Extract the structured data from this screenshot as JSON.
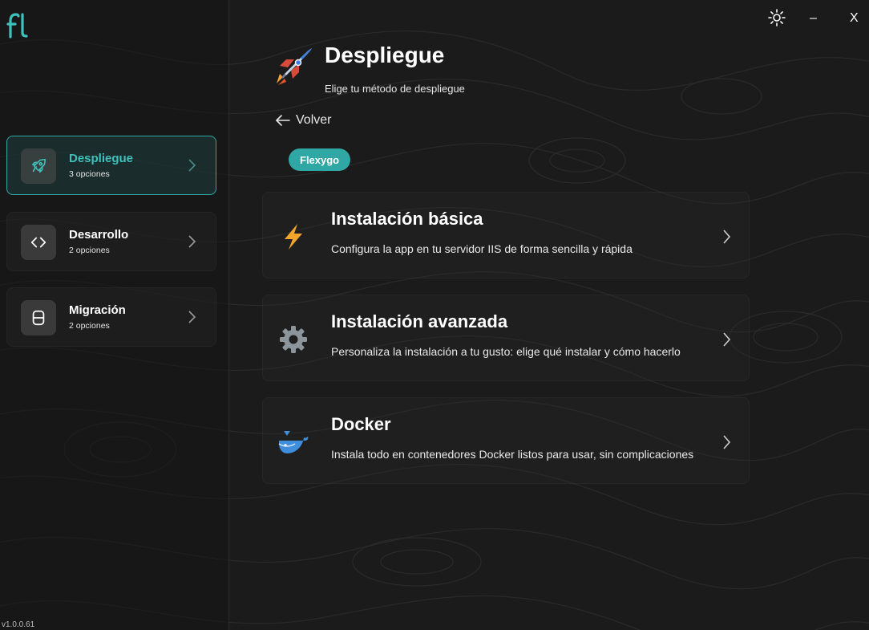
{
  "app": {
    "logo_text": "fl",
    "version": "v1.0.0.61"
  },
  "window": {
    "theme_icon": "sun-icon",
    "minimize_label": "–",
    "close_label": "X"
  },
  "sidebar": {
    "items": [
      {
        "label": "Despliegue",
        "sub": "3 opciones",
        "icon": "rocket-outline-icon",
        "active": true
      },
      {
        "label": "Desarrollo",
        "sub": "2 opciones",
        "icon": "code-brackets-icon",
        "active": false
      },
      {
        "label": "Migración",
        "sub": "2 opciones",
        "icon": "database-icon",
        "active": false
      }
    ]
  },
  "main": {
    "title": "Despliegue",
    "subtitle": "Elige tu método de despliegue",
    "back_label": "Volver",
    "chip_label": "Flexygo",
    "cards": [
      {
        "title": "Instalación básica",
        "desc": "Configura la app en tu servidor IIS de forma sencilla y rápida",
        "icon": "lightning-icon"
      },
      {
        "title": "Instalación avanzada",
        "desc": "Personaliza la instalación a tu gusto: elige qué instalar y cómo hacerlo",
        "icon": "gear-icon"
      },
      {
        "title": "Docker",
        "desc": "Instala todo en contenedores Docker listos para usar, sin complicaciones",
        "icon": "docker-whale-icon"
      }
    ]
  },
  "colors": {
    "accent": "#2fa7a4",
    "accent_text": "#3ec2bd",
    "background": "#1b1b1b"
  }
}
